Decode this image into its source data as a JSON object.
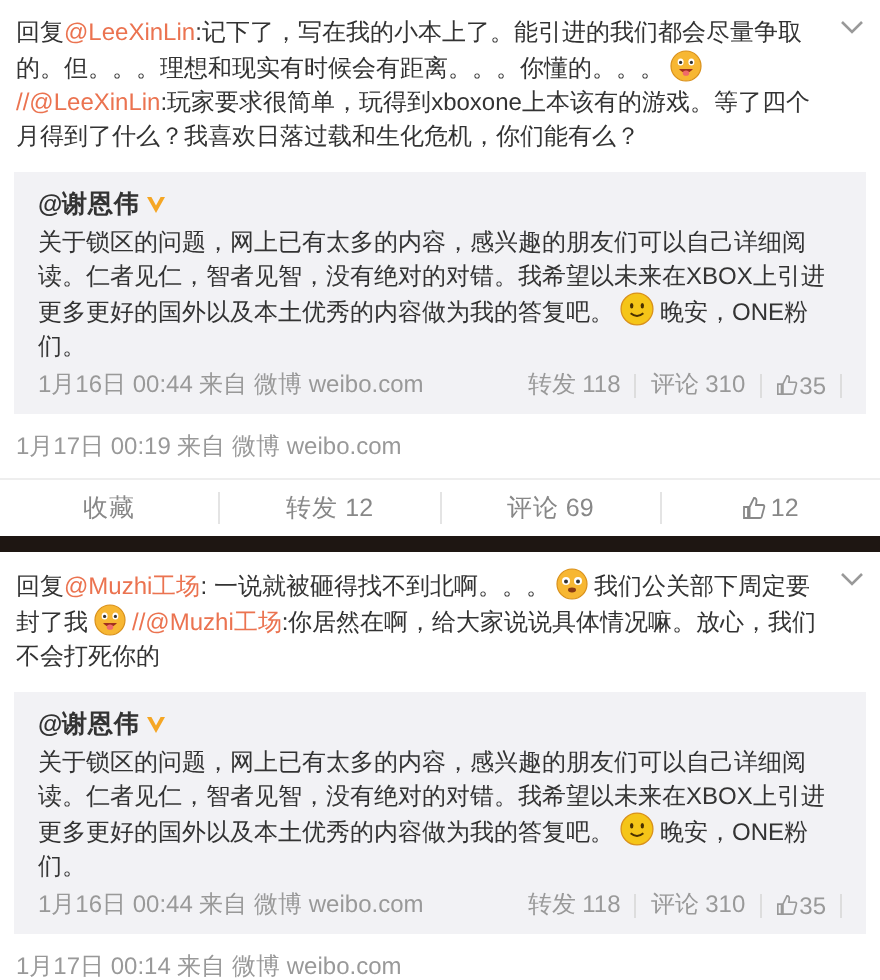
{
  "posts": [
    {
      "text": [
        {
          "kind": "text",
          "text": "回复"
        },
        {
          "kind": "mention",
          "text": "@LeeXinLin"
        },
        {
          "kind": "text",
          "text": ":记下了，写在我的小本上了。能引进的我们都会尽量争取的。但。。。理想和现实有时候会有距离。。。你懂的。。。"
        },
        {
          "kind": "tongue"
        },
        {
          "kind": "mention",
          "text": "//@LeeXinLin"
        },
        {
          "kind": "text",
          "text": ":玩家要求很简单，玩得到xboxone上本该有的游戏。等了四个月得到了什么？我喜欢日落过载和生化危机，你们能有么？"
        }
      ],
      "quote": {
        "author": "@谢恩伟",
        "verified": true,
        "text": [
          {
            "kind": "text",
            "text": "关于锁区的问题，网上已有太多的内容，感兴趣的朋友们可以自己详细阅读。仁者见仁，智者见智，没有绝对的对错。我希望以未来在XBOX上引进更多更好的国外以及本土优秀的内容做为我的答复吧。"
          },
          {
            "kind": "smile"
          },
          {
            "kind": "text",
            "text": "晚安，ONE粉们。"
          }
        ],
        "time": "1月16日 00:44 来自 微博 weibo.com",
        "stats": [
          {
            "kind": "repost",
            "text": "转发 118"
          },
          {
            "kind": "comment",
            "text": "评论 310"
          },
          {
            "kind": "like",
            "text": "35"
          }
        ]
      },
      "time": "1月17日 00:19 来自 微博 weibo.com",
      "actions": [
        {
          "kind": "favorite",
          "text": "收藏"
        },
        {
          "kind": "repost",
          "text": "转发 12"
        },
        {
          "kind": "comment",
          "text": "评论 69"
        },
        {
          "kind": "like",
          "text": "12"
        }
      ]
    },
    {
      "text": [
        {
          "kind": "text",
          "text": "回复"
        },
        {
          "kind": "mention",
          "text": "@Muzhi工场"
        },
        {
          "kind": "text",
          "text": ": 一说就被砸得找不到北啊。。。"
        },
        {
          "kind": "puzzled"
        },
        {
          "kind": "text",
          "text": "我们公关部下周定要封了我"
        },
        {
          "kind": "tongue"
        },
        {
          "kind": "mention",
          "text": "//@Muzhi工场"
        },
        {
          "kind": "text",
          "text": ":你居然在啊，给大家说说具体情况嘛。放心，我们不会打死你的"
        }
      ],
      "quote": {
        "author": "@谢恩伟",
        "verified": true,
        "text": [
          {
            "kind": "text",
            "text": "关于锁区的问题，网上已有太多的内容，感兴趣的朋友们可以自己详细阅读。仁者见仁，智者见智，没有绝对的对错。我希望以未来在XBOX上引进更多更好的国外以及本土优秀的内容做为我的答复吧。"
          },
          {
            "kind": "smile"
          },
          {
            "kind": "text",
            "text": "晚安，ONE粉们。"
          }
        ],
        "time": "1月16日 00:44 来自 微博 weibo.com",
        "stats": [
          {
            "kind": "repost",
            "text": "转发 118"
          },
          {
            "kind": "comment",
            "text": "评论 310"
          },
          {
            "kind": "like",
            "text": "35"
          }
        ]
      },
      "time": "1月17日 00:14 来自 微博 weibo.com"
    }
  ]
}
